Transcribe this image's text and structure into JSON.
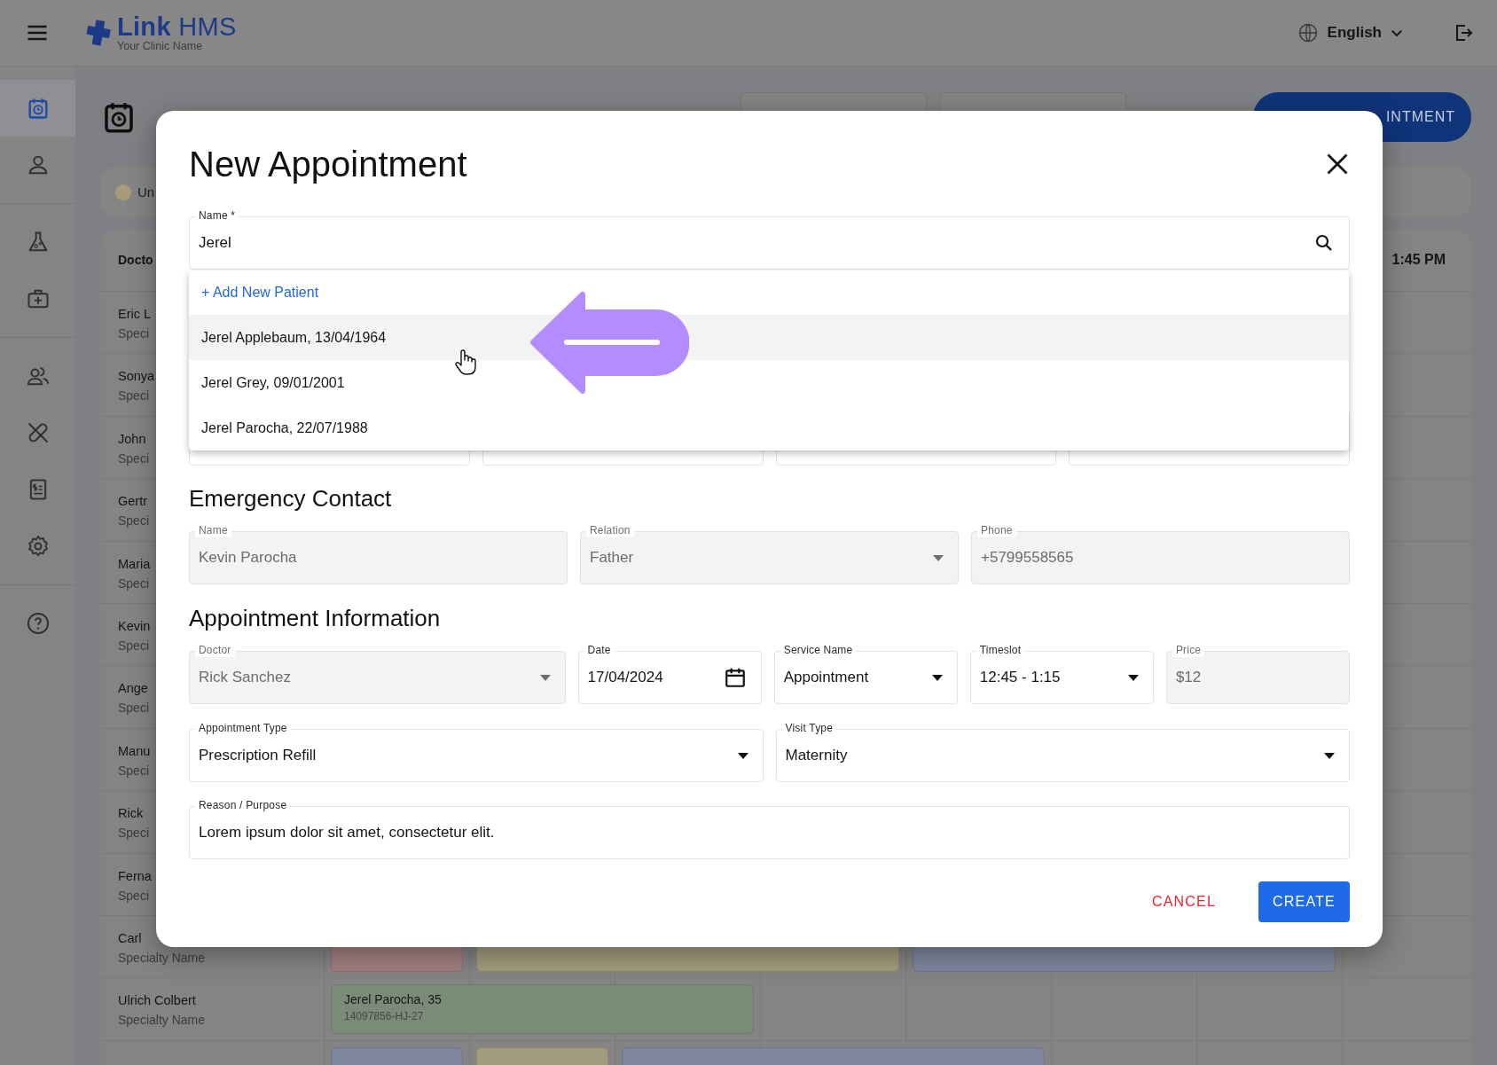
{
  "header": {
    "brand": "**Link** HMS",
    "clinic": "Your Clinic Name",
    "language": "English"
  },
  "sidebar": {
    "groups": [
      {
        "items": [
          {
            "kind": "calendar",
            "selected": true
          },
          {
            "kind": "person",
            "selected": false
          }
        ]
      },
      {
        "items": [
          {
            "kind": "flask",
            "selected": false
          },
          {
            "kind": "medkit",
            "selected": false
          }
        ]
      },
      {
        "items": [
          {
            "kind": "people",
            "selected": false
          },
          {
            "kind": "pill",
            "selected": false
          },
          {
            "kind": "invoice",
            "selected": false
          },
          {
            "kind": "gear",
            "selected": false
          }
        ]
      },
      {
        "items": [
          {
            "kind": "help",
            "selected": false
          }
        ]
      }
    ]
  },
  "schedule": {
    "toolbar_button": "INTMENT",
    "legend": [
      {
        "label": "Un",
        "color": "#a89b7b"
      }
    ],
    "doctor_header": "Docto",
    "time_header": "1:45 PM",
    "doctors": [
      {
        "name": "Eric L",
        "specialty": "Speci"
      },
      {
        "name": "Sonya",
        "specialty": "Speci"
      },
      {
        "name": "John",
        "specialty": "Speci"
      },
      {
        "name": "Gertr",
        "specialty": "Speci"
      },
      {
        "name": "Maria",
        "specialty": "Speci"
      },
      {
        "name": "Kevin",
        "specialty": "Speci"
      },
      {
        "name": "Ange",
        "specialty": "Speci"
      },
      {
        "name": "Manu",
        "specialty": "Speci"
      },
      {
        "name": "Rick",
        "specialty": "Speci"
      },
      {
        "name": "Ferna",
        "specialty": "Speci"
      },
      {
        "name": "Carl",
        "specialty": "Specialty Name",
        "appointments": [
          {
            "kind": "short",
            "color": "#a27f80"
          },
          {
            "kind": "long",
            "color": "#a39b7d"
          },
          {
            "kind": "long",
            "color": "#7d869c"
          }
        ]
      },
      {
        "name": "Ulrich Colbert",
        "specialty": "Specialty Name",
        "appointments": [
          {
            "kind": "long",
            "color": "#7a8b78",
            "patient": "Jerel Parocha, 35",
            "code": "14097856-HJ-27"
          }
        ]
      },
      {
        "appointments": [
          {
            "kind": "short",
            "color": "#7d869c"
          },
          {
            "kind": "short",
            "color": "#a39b7d"
          },
          {
            "kind": "long",
            "color": "#7d869c"
          }
        ]
      }
    ]
  },
  "modal": {
    "title": "New Appointment",
    "name_field": {
      "label": "Name *",
      "value": "Jerel",
      "suggestions": {
        "add_new": "+ Add New Patient",
        "items": [
          {
            "text": "Jerel Applebaum, 13/04/1964",
            "selected": true
          },
          {
            "text": "Jerel Grey, 09/01/2001",
            "selected": false
          },
          {
            "text": "Jerel Parocha, 22/07/1988",
            "selected": false
          }
        ]
      }
    },
    "emergency_contact": {
      "title": "Emergency Contact",
      "fields": [
        {
          "label": "Name",
          "value": "Kevin Parocha",
          "kind": "text",
          "disabled": true
        },
        {
          "label": "Relation",
          "value": "Father",
          "kind": "select",
          "disabled": true
        },
        {
          "label": "Phone",
          "value": "+5799558565",
          "kind": "text",
          "disabled": true
        }
      ]
    },
    "appointment_info": {
      "title": "Appointment Information",
      "rows": [
        {
          "fields": [
            {
              "label": "Doctor",
              "value": "Rick Sanchez",
              "kind": "select",
              "disabled": true
            },
            {
              "label": "Date",
              "value": "17/04/2024",
              "kind": "date",
              "disabled": false
            },
            {
              "label": "Service Name",
              "value": "Appointment",
              "kind": "select",
              "disabled": false
            },
            {
              "label": "Timeslot",
              "value": "12:45 - 1:15",
              "kind": "select",
              "disabled": false
            },
            {
              "label": "Price",
              "value": "$12",
              "kind": "text",
              "disabled": true
            }
          ]
        },
        {
          "fields": [
            {
              "label": "Appointment Type",
              "value": "Prescription Refill",
              "kind": "select",
              "disabled": false
            },
            {
              "label": "Visit Type",
              "value": "Maternity",
              "kind": "select",
              "disabled": false
            }
          ]
        },
        {
          "fields": [
            {
              "label": "Reason / Purpose",
              "value": "Lorem ipsum dolor sit amet, consectetur elit.",
              "kind": "text",
              "disabled": false
            }
          ]
        }
      ]
    },
    "actions": [
      {
        "label": "CANCEL",
        "kind": "text"
      },
      {
        "label": "CREATE",
        "kind": "primary"
      }
    ]
  }
}
